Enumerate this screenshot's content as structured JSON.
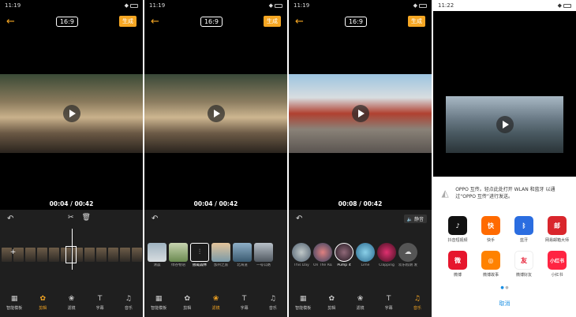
{
  "panels": [
    {
      "status_time": "11:19",
      "ratio": "16:9",
      "generate": "生成",
      "time": "00:04 / 00:42",
      "nav_active": "剪辑"
    },
    {
      "status_time": "11:19",
      "ratio": "16:9",
      "generate": "生成",
      "time": "00:04 / 00:42",
      "nav_active": "滤镜",
      "presets": [
        {
          "label": "清晨"
        },
        {
          "label": "绿谷物语"
        },
        {
          "label": "挪威森林"
        },
        {
          "label": "加州之旅"
        },
        {
          "label": "北海道"
        },
        {
          "label": "一号公路"
        }
      ]
    },
    {
      "status_time": "11:19",
      "ratio": "16:9",
      "generate": "生成",
      "time": "00:08 / 00:42",
      "nav_active": "音乐",
      "mute": "静音",
      "presets": [
        {
          "label": "This Day"
        },
        {
          "label": "On The Road"
        },
        {
          "label": "Pump it"
        },
        {
          "label": "Lime"
        },
        {
          "label": "Clapping"
        },
        {
          "label": "欢乐假期 发"
        }
      ]
    },
    {
      "status_time": "11:22"
    }
  ],
  "nav": [
    {
      "label": "智能模板",
      "icon": "grid-icon"
    },
    {
      "label": "剪辑",
      "icon": "film-icon"
    },
    {
      "label": "滤镜",
      "icon": "filter-icon"
    },
    {
      "label": "字幕",
      "icon": "text-icon"
    },
    {
      "label": "音乐",
      "icon": "music-icon"
    }
  ],
  "share": {
    "oppo_text": "OPPO 互传。轻点此处打开 WLAN 和蓝牙 以通过“OPPO 互传”进行发送。",
    "apps": [
      {
        "label": "抖音短视频",
        "icon_text": "♪",
        "color": "#111111"
      },
      {
        "label": "快手",
        "icon_text": "快",
        "color": "#ff6a00"
      },
      {
        "label": "蓝牙",
        "icon_text": "ᛒ",
        "color": "#2b6de0"
      },
      {
        "label": "网易邮箱大师",
        "icon_text": "邮",
        "color": "#d9262c"
      },
      {
        "label": "微博",
        "icon_text": "微",
        "color": "#e6162d"
      },
      {
        "label": "微博故事",
        "icon_text": "◎",
        "color": "#ff8200"
      },
      {
        "label": "微博好友",
        "icon_text": "友",
        "color": "#ffffff"
      },
      {
        "label": "小红书",
        "icon_text": "小红书",
        "color": "#ff2442"
      }
    ],
    "cancel": "取消"
  }
}
